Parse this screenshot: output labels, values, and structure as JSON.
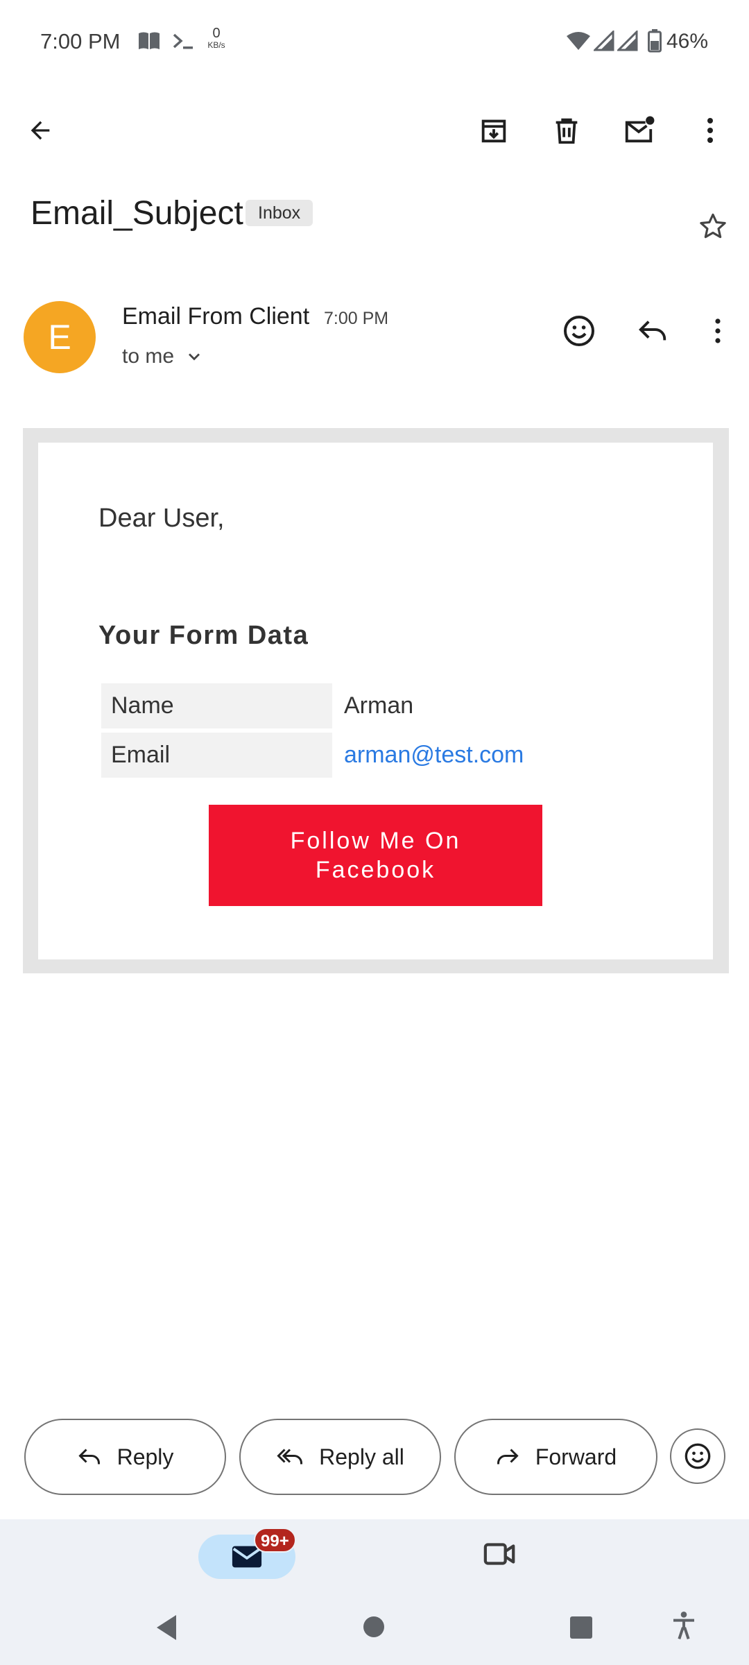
{
  "status_bar": {
    "time": "7:00 PM",
    "net_speed_value": "0",
    "net_speed_unit": "KB/s",
    "battery": "46%"
  },
  "toolbar": {
    "icons": [
      "back-arrow-icon",
      "archive-icon",
      "trash-icon",
      "mark-unread-icon",
      "more-vert-icon"
    ]
  },
  "email": {
    "subject": "Email_Subject",
    "label_chip": "Inbox",
    "sender_initial": "E",
    "sender_name": "Email From Client",
    "time": "7:00 PM",
    "recipient": "to me",
    "avatar_color": "#f5a623"
  },
  "body": {
    "greeting": "Dear User,",
    "section_title": "Your Form Data",
    "rows": [
      {
        "label": "Name",
        "value": "Arman"
      },
      {
        "label": "Email",
        "value": "arman@test.com"
      }
    ],
    "cta_label": "Follow Me On Facebook",
    "cta_color": "#f0142f",
    "link_color": "#2a7ae2"
  },
  "actions": {
    "reply": "Reply",
    "reply_all": "Reply all",
    "forward": "Forward"
  },
  "bottom_nav": {
    "mail_badge": "99+",
    "active_tab": "mail"
  }
}
